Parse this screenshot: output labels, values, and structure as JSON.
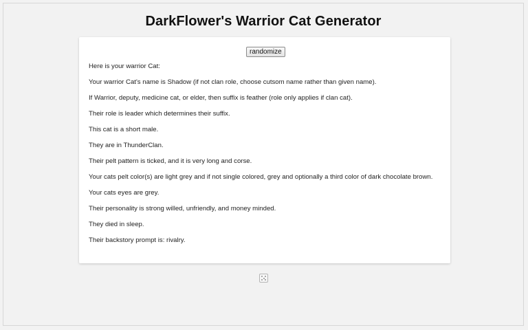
{
  "header": {
    "title": "DarkFlower's Warrior Cat Generator"
  },
  "card": {
    "randomize_label": "randomize",
    "lines": [
      "Here is your warrior Cat:",
      "Your warrior Cat's name is Shadow (if not clan role, choose cutsom name rather than given name).",
      "If Warrior, deputy, medicine cat, or elder, then suffix is feather (role only applies if clan cat).",
      "Their role is leader which determines their suffix.",
      "This cat is a short male.",
      "They are in ThunderClan.",
      "Their pelt pattern is ticked, and it is very long and corse.",
      "Your cats pelt color(s) are light grey and if not single colored, grey and optionally a third color of dark chocolate brown.",
      "Your cats eyes are grey.",
      "Their personality is strong willed, unfriendly, and money minded.",
      "They died in sleep.",
      "Their backstory prompt is: rivalry."
    ]
  },
  "footer": {
    "icon": "dice-icon"
  }
}
